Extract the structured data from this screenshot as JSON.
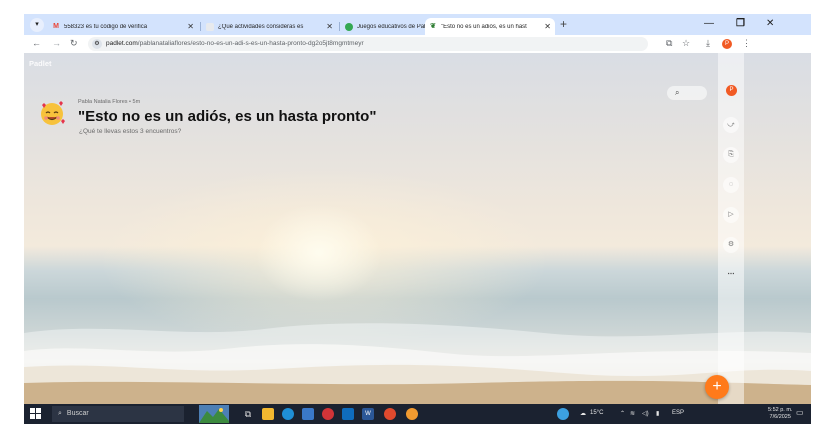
{
  "browser": {
    "tabs": [
      {
        "favicon": "gmail-icon",
        "title": "558323 es tu código de verifica",
        "active": false
      },
      {
        "favicon": "document-icon",
        "title": "¿Qué actividades consideras es",
        "active": false
      },
      {
        "favicon": "circle-green-icon",
        "title": "Juegos educativos de Pabla Nat",
        "active": false
      },
      {
        "favicon": "padlet-icon",
        "title": "\"Esto no es un adiós, es un hast",
        "active": true
      }
    ],
    "url_host": "padlet.com",
    "url_path": "/pablanataliaflores/esto-no-es-un-adi-s-es-un-hasta-pronto-dg2o5jt8mgmtmeyr",
    "profile_initial": "P",
    "colors": {
      "tabstrip": "#d3e3fd",
      "accent": "#f15a24"
    }
  },
  "padlet": {
    "logo": "Padlet",
    "author": "Pabla Natalia Flores • 5m",
    "title": "\"Esto no es un adiós, es un hasta pronto\"",
    "subtitle": "¿Qué te llevas estos 3 encuentros?",
    "rail_avatar_initial": "P",
    "rail_icons": [
      "remake-icon",
      "share-icon",
      "bell-icon",
      "slideshow-icon",
      "settings-icon",
      "more-icon"
    ],
    "fab_label": "+",
    "colors": {
      "fab": "#ff7a1a",
      "title": "#111111"
    }
  },
  "taskbar": {
    "search_placeholder": "Buscar",
    "apps": [
      "task-view-icon",
      "file-explorer-icon",
      "edge-icon",
      "store-icon",
      "app-icon",
      "mail-icon",
      "word-icon",
      "chrome-icon",
      "chrome-profile-icon"
    ],
    "weather": "15°C",
    "language": "ESP",
    "time": "5:52 p. m.",
    "date": "7/6/2025"
  }
}
